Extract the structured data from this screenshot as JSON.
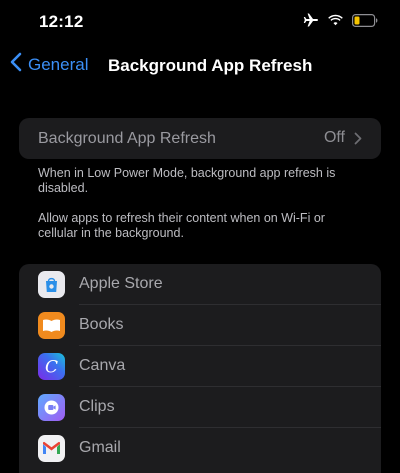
{
  "status_bar": {
    "time": "12:12",
    "icons": [
      "airplane-icon",
      "wifi-icon",
      "battery-icon"
    ],
    "battery_color": "#f5c400"
  },
  "nav": {
    "back_label": "General",
    "title": "Background App Refresh"
  },
  "setting": {
    "label": "Background App Refresh",
    "value": "Off"
  },
  "footnotes": {
    "low_power": "When in Low Power Mode, background app refresh is disabled.",
    "description": "Allow apps to refresh their content when on Wi-Fi or cellular in the background."
  },
  "apps": [
    {
      "name": "Apple Store",
      "icon": "apple-store-icon"
    },
    {
      "name": "Books",
      "icon": "books-icon"
    },
    {
      "name": "Canva",
      "icon": "canva-icon"
    },
    {
      "name": "Clips",
      "icon": "clips-icon"
    },
    {
      "name": "Gmail",
      "icon": "gmail-icon"
    }
  ],
  "colors": {
    "accent": "#3b8ff6",
    "background": "#000000",
    "card": "#1c1c1e"
  }
}
